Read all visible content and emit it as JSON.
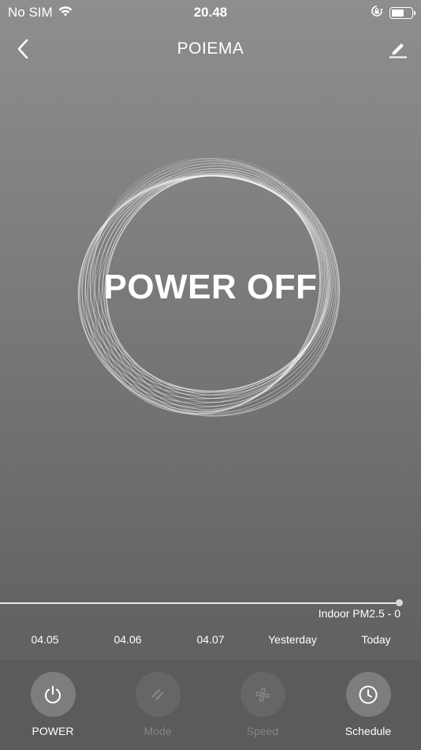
{
  "status_bar": {
    "carrier": "No SIM",
    "time": "20.48",
    "battery_level": 0.62
  },
  "nav": {
    "title": "POIEMA"
  },
  "power_ring": {
    "label": "POWER OFF"
  },
  "timeline": {
    "pm_label": "Indoor PM2.5 - 0",
    "dates": [
      "04.05",
      "04.06",
      "04.07",
      "Yesterday",
      "Today"
    ]
  },
  "controls": [
    {
      "label": "POWER",
      "icon": "power-icon",
      "enabled": true
    },
    {
      "label": "Mode",
      "icon": "mode-icon",
      "enabled": false
    },
    {
      "label": "Speed",
      "icon": "fan-icon",
      "enabled": false
    },
    {
      "label": "Schedule",
      "icon": "clock-icon",
      "enabled": true
    }
  ],
  "colors": {
    "background_top": "#8e8e8e",
    "background_bottom": "#5e5e5e",
    "control_bar": "#5b5b5b",
    "button_circle": "#7d7d7d"
  }
}
